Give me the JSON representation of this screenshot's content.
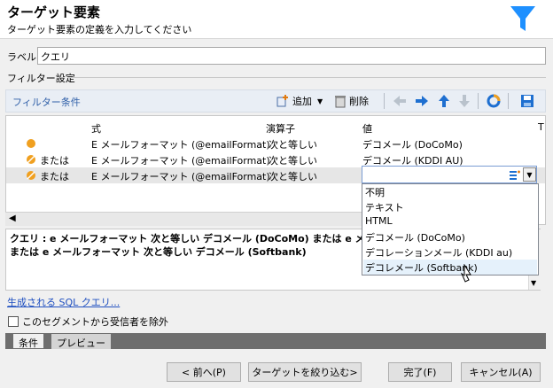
{
  "header": {
    "title": "ターゲット要素",
    "subtitle": "ターゲット要素の定義を入力してください"
  },
  "label_field": {
    "label": "ラベル:",
    "value": "クエリ"
  },
  "filter_settings": {
    "legend": "フィルター設定",
    "toolbar": {
      "filter_label": "フィルター条件",
      "add_label": "追加",
      "delete_label": "削除"
    }
  },
  "grid": {
    "columns": [
      "式",
      "演算子",
      "値",
      "T"
    ],
    "rows": [
      {
        "prefix": "",
        "expr": "E メールフォーマット (@emailFormat)",
        "op": "次と等しい",
        "value": "デコメール (DoCoMo)"
      },
      {
        "prefix": "または",
        "expr": "E メールフォーマット (@emailFormat)",
        "op": "次と等しい",
        "value": "デコメール (KDDI AU)"
      },
      {
        "prefix": "または",
        "expr": "E メールフォーマット (@emailFormat)",
        "op": "次と等しい",
        "value": ""
      }
    ]
  },
  "dropdown": {
    "options": [
      "不明",
      "テキスト",
      "HTML",
      "デコメール (DoCoMo)",
      "デコレーションメール (KDDI au)",
      "デコレメール (Softbank)"
    ],
    "hovered_index": 5
  },
  "sql_summary": {
    "line1": "クエリ : e メールフォーマット 次と等しい デコメール (DoCoMo) または e メール",
    "line2": "または e メールフォーマット 次と等しい デコメール (Softbank)"
  },
  "sql_link": "生成される SQL クエリ...",
  "exclude_checkbox": {
    "label": "このセグメントから受信者を除外",
    "checked": false
  },
  "tabs": [
    "条件",
    "プレビュー"
  ],
  "active_tab": 0,
  "buttons": {
    "back": "< 前へ(P)",
    "narrow": "ターゲットを絞り込む>",
    "finish": "完了(F)",
    "cancel": "キャンセル(A)"
  },
  "colors": {
    "accent_blue": "#1e90ff",
    "funnel": "#1e90ff",
    "bullet_orange": "#f0a020",
    "link": "#2050c0",
    "selected_row": "#e6e6e6"
  },
  "icons": [
    "funnel-icon",
    "add-icon",
    "delete-icon",
    "arrow-left-icon",
    "arrow-right-icon",
    "arrow-up-icon",
    "arrow-down-icon",
    "chart-icon",
    "save-icon"
  ]
}
